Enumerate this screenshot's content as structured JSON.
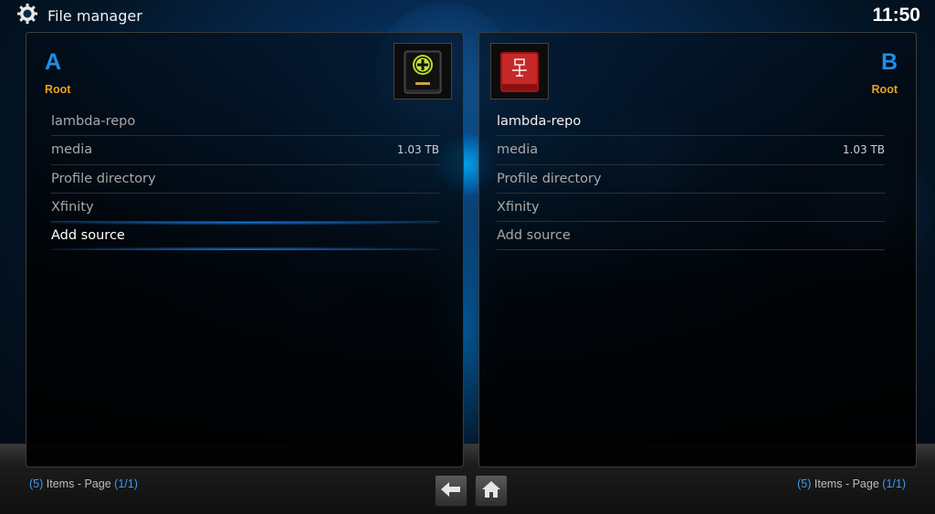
{
  "header": {
    "title": "File manager",
    "clock": "11:50",
    "icon": "gear-icon"
  },
  "panels": {
    "left": {
      "letter": "A",
      "path": "Root",
      "thumb_icon": "add-drive-icon",
      "items": [
        {
          "label": "lambda-repo",
          "size": ""
        },
        {
          "label": "media",
          "size": "1.03 TB"
        },
        {
          "label": "Profile directory",
          "size": ""
        },
        {
          "label": "Xfinity",
          "size": ""
        },
        {
          "label": "Add source",
          "size": ""
        }
      ],
      "footer": {
        "count": "5",
        "items_text": "Items - Page",
        "page": "1/1"
      }
    },
    "right": {
      "letter": "B",
      "path": "Root",
      "thumb_icon": "network-drive-icon",
      "items": [
        {
          "label": "lambda-repo",
          "size": ""
        },
        {
          "label": "media",
          "size": "1.03 TB"
        },
        {
          "label": "Profile directory",
          "size": ""
        },
        {
          "label": "Xfinity",
          "size": ""
        },
        {
          "label": "Add source",
          "size": ""
        }
      ],
      "footer": {
        "count": "5",
        "items_text": "Items - Page",
        "page": "1/1"
      }
    }
  },
  "nav": {
    "back_icon": "back-arrow-icon",
    "home_icon": "home-icon"
  },
  "colors": {
    "accent": "#1e8fe8",
    "path": "#e8a21c",
    "selection": "#1e8cff"
  }
}
